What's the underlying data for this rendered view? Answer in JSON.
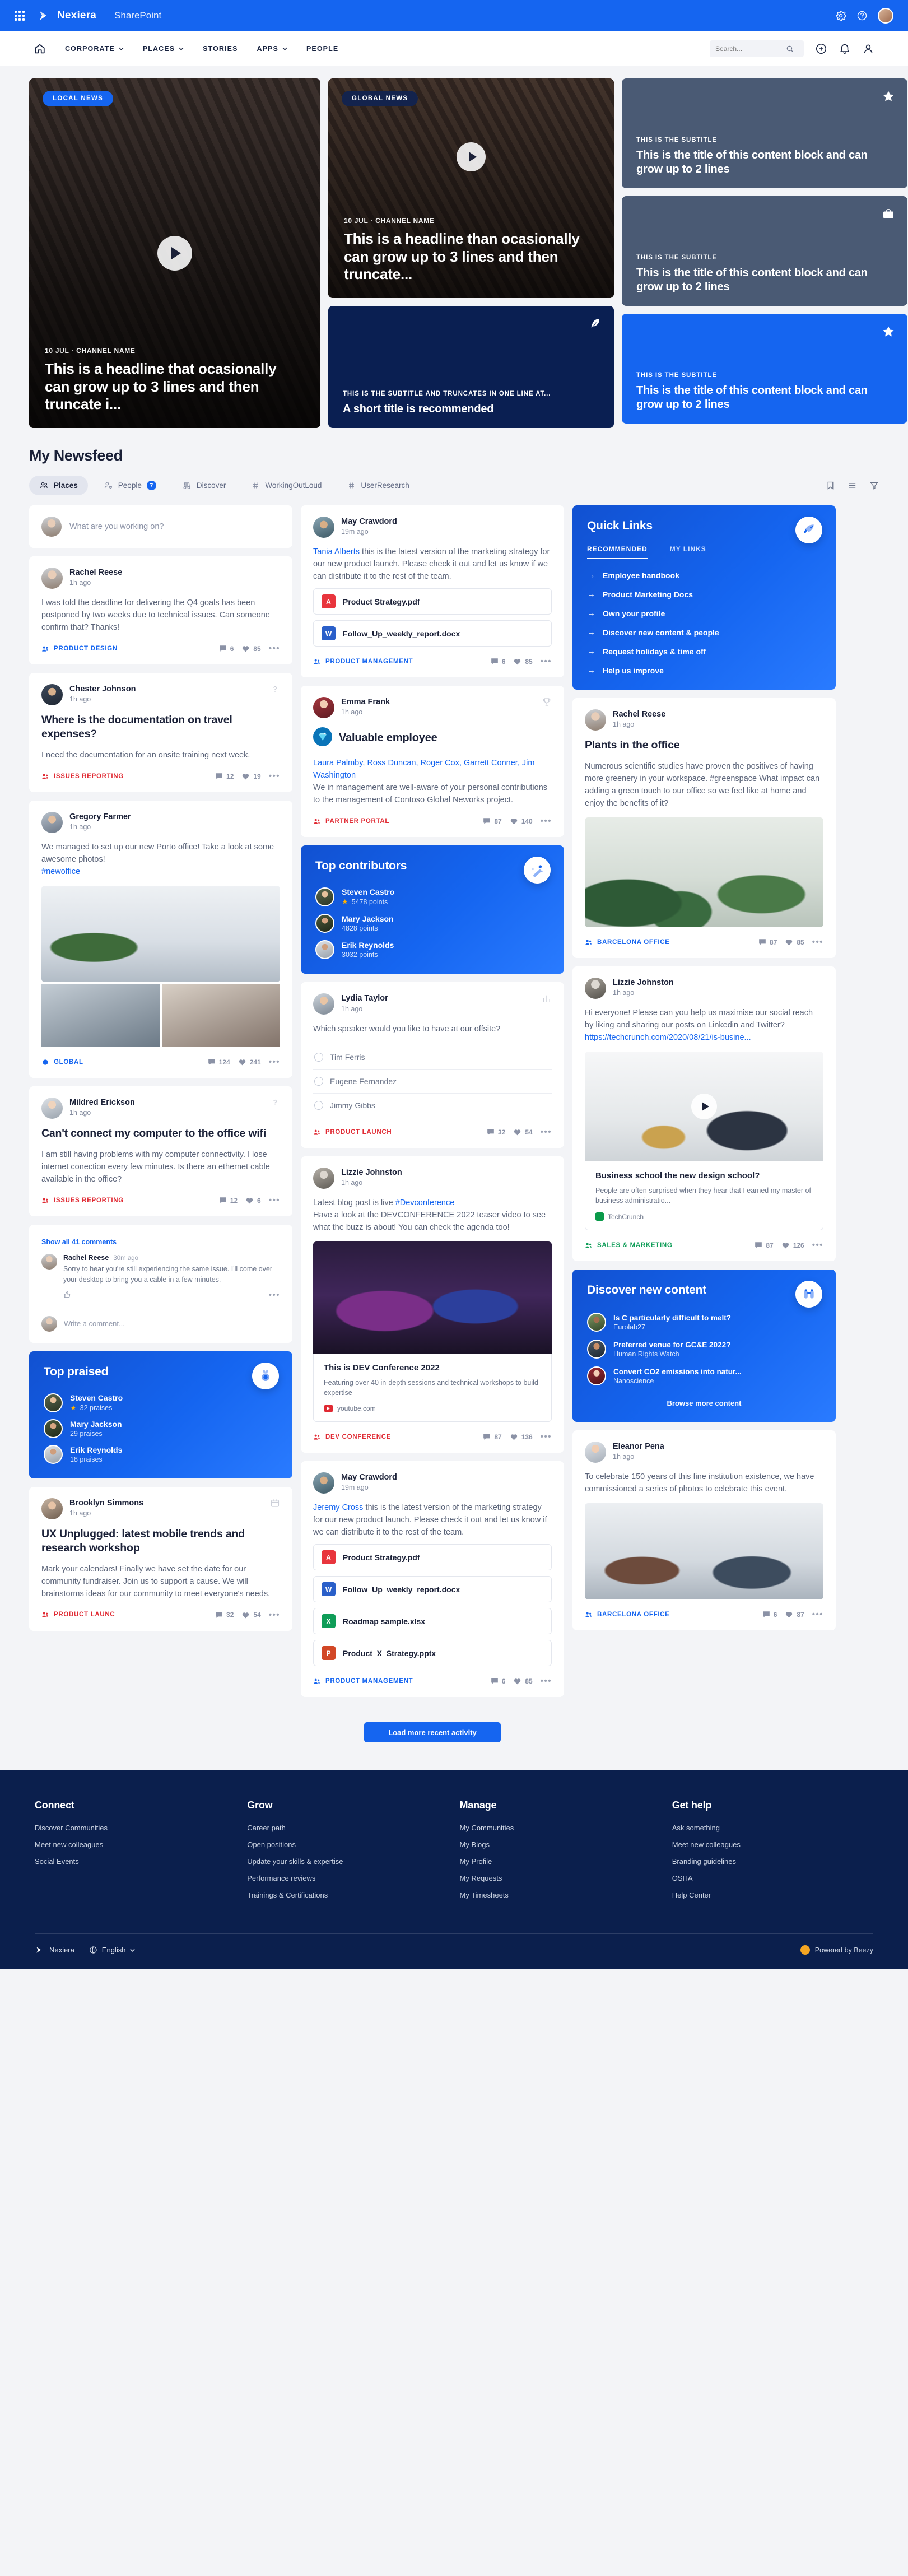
{
  "topbar": {
    "waffle_label": "app-launcher",
    "brand": "Nexiera",
    "product": "SharePoint",
    "icons": [
      "settings-icon",
      "help-icon",
      "user-avatar"
    ]
  },
  "nav": {
    "home_label": "Home",
    "items": [
      {
        "label": "CORPORATE",
        "caret": true
      },
      {
        "label": "PLACES",
        "caret": true
      },
      {
        "label": "STORIES",
        "caret": false
      },
      {
        "label": "APPS",
        "caret": true
      },
      {
        "label": "PEOPLE",
        "caret": false
      }
    ],
    "search_placeholder": "Search...",
    "right_icons": [
      "plus-icon",
      "bell-icon",
      "person-icon"
    ]
  },
  "hero": {
    "big": {
      "badge": "LOCAL NEWS",
      "meta": "10 JUL · CHANNEL NAME",
      "title": "This is a headline that ocasionally can grow up to 3 lines and then truncate i...",
      "has_play": true
    },
    "mid": {
      "badge": "GLOBAL NEWS",
      "meta": "10 JUL · CHANNEL NAME",
      "title": "This is a headline than ocasionally can grow up to 3 lines and then truncate...",
      "has_play": true
    },
    "mid_dark": {
      "subtitle": "THIS IS THE SUBTITLE AND TRUNCATES IN ONE LINE AT...",
      "title": "A short title is recommended",
      "icon": "feather-icon"
    },
    "side": [
      {
        "subtitle": "THIS IS THE SUBTITLE",
        "title": "This is the title of this content block and can grow up to 2 lines",
        "icon": "star-icon",
        "style": "slate"
      },
      {
        "subtitle": "THIS IS THE SUBTITLE",
        "title": "This is the title of this content block and can grow up to 2 lines",
        "icon": "briefcase-icon",
        "style": "slate"
      },
      {
        "subtitle": "THIS IS THE SUBTITLE",
        "title": "This is the title of this content block and can grow up to 2 lines",
        "icon": "star-icon",
        "style": "blue"
      }
    ]
  },
  "feed": {
    "title": "My Newsfeed",
    "filters": [
      {
        "label": "Places",
        "icon": "people-group-icon",
        "active": true,
        "count": null
      },
      {
        "label": "People",
        "icon": "person-heart-icon",
        "active": false,
        "count": "7"
      },
      {
        "label": "Discover",
        "icon": "binoculars-icon",
        "active": false,
        "count": null
      },
      {
        "label": "WorkingOutLoud",
        "icon": "hash-icon",
        "active": false,
        "count": null
      },
      {
        "label": "UserResearch",
        "icon": "hash-icon",
        "active": false,
        "count": null
      }
    ],
    "right_icons": [
      "bookmark-icon",
      "list-icon",
      "filter-icon"
    ],
    "composer_placeholder": "What are you working on?"
  },
  "posts": {
    "rachel": {
      "name": "Rachel Reese",
      "time": "1h ago",
      "text": "I was told the deadline for delivering the Q4 goals has been postponed by two weeks due to technical issues. Can someone confirm that? Thanks!",
      "channel": "PRODUCT DESIGN",
      "comments": "6",
      "likes": "85"
    },
    "chester": {
      "name": "Chester Johnson",
      "time": "1h ago",
      "title": "Where is the documentation on travel expenses?",
      "text": "I need the documentation for an onsite training next week.",
      "channel": "ISSUES REPORTING",
      "comments": "12",
      "likes": "19"
    },
    "gregory": {
      "name": "Gregory Farmer",
      "time": "1h ago",
      "text": "We managed to set up our new Porto office! Take a look at some awesome photos!",
      "hashtag": "#newoffice",
      "channel": "GLOBAL",
      "comments": "124",
      "likes": "241"
    },
    "mildred": {
      "name": "Mildred Erickson",
      "time": "1h ago",
      "title": "Can't connect my computer to the office wifi",
      "text": "I am still having problems with my computer connectivity. I lose internet conection every few minutes. Is there an ethernet cable available in the office?",
      "channel": "ISSUES REPORTING",
      "comments": "12",
      "likes": "6",
      "show_comments": "Show all 41 comments",
      "comment": {
        "name": "Rachel Reese",
        "time": "30m ago",
        "body": "Sorry to hear you're still experiencing the same issue. I'll come over your desktop to bring you a cable in a few minutes."
      },
      "comment_placeholder": "Write a comment..."
    },
    "brooklyn": {
      "name": "Brooklyn Simmons",
      "time": "1h ago",
      "title": "UX Unplugged: latest mobile trends and research workshop",
      "text": "Mark your calendars! Finally we have set the date for our community fundraiser. Join us to support a cause. We will brainstorms ideas for our community to meet everyone's needs.",
      "channel": "PRODUCT LAUNC",
      "comments": "32",
      "likes": "54"
    },
    "may": {
      "name": "May Crawdord",
      "time": "19m ago",
      "mention": "Tania Alberts",
      "text": " this is the latest version of the marketing strategy for our new product launch. Please check it out and let us know if we can distribute it to the rest of the team.",
      "files": [
        {
          "name": "Product Strategy.pdf",
          "type": "pdf",
          "glyph": "A"
        },
        {
          "name": "Follow_Up_weekly_report.docx",
          "type": "doc",
          "glyph": "W"
        }
      ],
      "channel": "PRODUCT MANAGEMENT",
      "comments": "6",
      "likes": "85"
    },
    "emma": {
      "name": "Emma Frank",
      "time": "1h ago",
      "badge_title": "Valuable employee",
      "mention": "Laura Palmby, Ross Duncan, Roger Cox, Garrett Conner, Jim Washington",
      "text": "We in management are well-aware of your personal contributions to the management of Contoso Global Neworks project.",
      "channel": "PARTNER PORTAL",
      "comments": "87",
      "likes": "140",
      "head_icon": "trophy-icon"
    },
    "lydia": {
      "name": "Lydia Taylor",
      "time": "1h ago",
      "question": "Which speaker would you like to have at our offsite?",
      "options": [
        "Tim Ferris",
        "Eugene Fernandez",
        "Jimmy Gibbs"
      ],
      "channel": "PRODUCT LAUNCH",
      "comments": "32",
      "likes": "54",
      "head_icon": "poll-icon"
    },
    "lizzie_conf": {
      "name": "Lizzie Johnston",
      "time": "1h ago",
      "text_pre": "Latest blog post is live ",
      "hashtag": "#Devconference",
      "text_post": "Have a look at the DEVCONFERENCE 2022 teaser video to see what the buzz is about! You can check the agenda too!",
      "card_title": "This is DEV Conference 2022",
      "card_desc": "Featuring over 40 in-depth sessions and technical workshops to build expertise",
      "card_src": "youtube.com",
      "channel": "DEV CONFERENCE",
      "comments": "87",
      "likes": "136"
    },
    "may2": {
      "name": "May Crawdord",
      "time": "19m ago",
      "mention": "Jeremy Cross",
      "text": " this is the latest version of the marketing strategy for our new product launch. Please check it out and let us know if we can distribute it to the rest of the team.",
      "files": [
        {
          "name": "Product Strategy.pdf",
          "type": "pdf",
          "glyph": "A"
        },
        {
          "name": "Follow_Up_weekly_report.docx",
          "type": "doc",
          "glyph": "W"
        },
        {
          "name": "Roadmap sample.xlsx",
          "type": "xls",
          "glyph": "X"
        },
        {
          "name": "Product_X_Strategy.pptx",
          "type": "ppt",
          "glyph": "P"
        }
      ],
      "channel": "PRODUCT MANAGEMENT",
      "comments": "6",
      "likes": "85"
    },
    "rachel2": {
      "name": "Rachel Reese",
      "time": "1h ago",
      "title": "Plants in the office",
      "text": "Numerous scientific studies have proven the positives of having more greenery in your workspace. #greenspace What impact can adding a green touch to our office so we feel like at home and enjoy the benefits of it?",
      "channel": "BARCELONA OFFICE",
      "comments": "87",
      "likes": "85"
    },
    "lizzie_social": {
      "name": "Lizzie Johnston",
      "time": "1h ago",
      "text": "Hi everyone! Please can you help us maximise our social reach by liking and sharing our posts on Linkedin and Twitter?",
      "link": "https://techcrunch.com/2020/08/21/is-busine...",
      "card_title": "Business school the new design school?",
      "card_desc": "People are often surprised when they hear that I earned my master of business administratio...",
      "card_src": "TechCrunch",
      "channel": "SALES & MARKETING",
      "comments": "87",
      "likes": "126"
    },
    "eleanor": {
      "name": "Eleanor Pena",
      "time": "1h ago",
      "text": "To celebrate 150 years of this fine institution existence, we have commissioned a series of photos to celebrate this event.",
      "channel": "BARCELONA OFFICE",
      "comments": "6",
      "likes": "87"
    }
  },
  "quick_links": {
    "title": "Quick Links",
    "icon": "rocket-icon",
    "tabs": [
      {
        "label": "RECOMMENDED",
        "active": true
      },
      {
        "label": "MY LINKS",
        "active": false
      }
    ],
    "links": [
      "Employee handbook",
      "Product Marketing Docs",
      "Own your profile",
      "Discover new content & people",
      "Request holidays & time off",
      "Help us improve"
    ]
  },
  "top_contributors": {
    "title": "Top contributors",
    "icon": "magic-wand-icon",
    "people": [
      {
        "name": "Steven Castro",
        "points": "5478 points",
        "star": true
      },
      {
        "name": "Mary Jackson",
        "points": "4828 points",
        "star": false
      },
      {
        "name": "Erik Reynolds",
        "points": "3032 points",
        "star": false
      }
    ]
  },
  "top_praised": {
    "title": "Top praised",
    "icon": "medal-icon",
    "people": [
      {
        "name": "Steven Castro",
        "points": "32 praises",
        "star": true
      },
      {
        "name": "Mary Jackson",
        "points": "29 praises",
        "star": false
      },
      {
        "name": "Erik Reynolds",
        "points": "18 praises",
        "star": false
      }
    ]
  },
  "discover_panel": {
    "title": "Discover new content",
    "icon": "binoculars-icon",
    "items": [
      {
        "title": "Is C particularly difficult to melt?",
        "sub": "Eurolab27"
      },
      {
        "title": "Preferred venue for GC&E 2022?",
        "sub": "Human Rights Watch"
      },
      {
        "title": "Convert CO2 emissions into natur...",
        "sub": "Nanoscience"
      }
    ],
    "button": "Browse more content"
  },
  "load_more": "Load more recent activity",
  "footer": {
    "columns": [
      {
        "title": "Connect",
        "links": [
          "Discover Communities",
          "Meet new colleagues",
          "Social Events"
        ]
      },
      {
        "title": "Grow",
        "links": [
          "Career path",
          "Open positions",
          "Update your skills & expertise",
          "Performance reviews",
          "Trainings & Certifications"
        ]
      },
      {
        "title": "Manage",
        "links": [
          "My Communities",
          "My Blogs",
          "My Profile",
          "My Requests",
          "My Timesheets"
        ]
      },
      {
        "title": "Get help",
        "links": [
          "Ask something",
          "Meet new colleagues",
          "Branding guidelines",
          "OSHA",
          "Help Center"
        ]
      }
    ],
    "brand": "Nexiera",
    "language": "English",
    "powered_by": "Powered by Beezy"
  }
}
